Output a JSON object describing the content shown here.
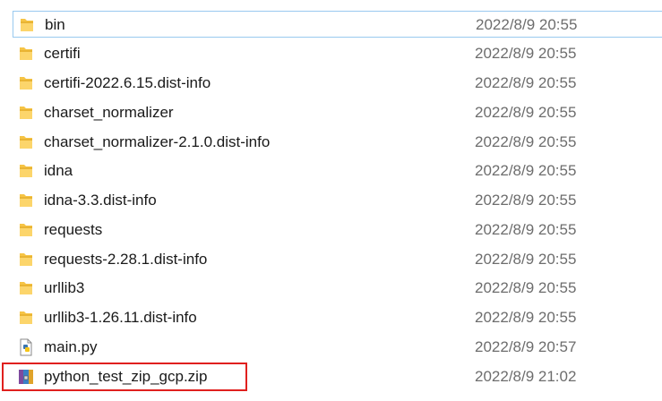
{
  "files": [
    {
      "name": "bin",
      "date": "2022/8/9 20:55",
      "icon": "folder-icon"
    },
    {
      "name": "certifi",
      "date": "2022/8/9 20:55",
      "icon": "folder-icon"
    },
    {
      "name": "certifi-2022.6.15.dist-info",
      "date": "2022/8/9 20:55",
      "icon": "folder-icon"
    },
    {
      "name": "charset_normalizer",
      "date": "2022/8/9 20:55",
      "icon": "folder-icon"
    },
    {
      "name": "charset_normalizer-2.1.0.dist-info",
      "date": "2022/8/9 20:55",
      "icon": "folder-icon"
    },
    {
      "name": "idna",
      "date": "2022/8/9 20:55",
      "icon": "folder-icon"
    },
    {
      "name": "idna-3.3.dist-info",
      "date": "2022/8/9 20:55",
      "icon": "folder-icon"
    },
    {
      "name": "requests",
      "date": "2022/8/9 20:55",
      "icon": "folder-icon"
    },
    {
      "name": "requests-2.28.1.dist-info",
      "date": "2022/8/9 20:55",
      "icon": "folder-icon"
    },
    {
      "name": "urllib3",
      "date": "2022/8/9 20:55",
      "icon": "folder-icon"
    },
    {
      "name": "urllib3-1.26.11.dist-info",
      "date": "2022/8/9 20:55",
      "icon": "folder-icon"
    },
    {
      "name": "main.py",
      "date": "2022/8/9 20:57",
      "icon": "python-file-icon"
    },
    {
      "name": "python_test_zip_gcp.zip",
      "date": "2022/8/9 21:02",
      "icon": "zip-archive-icon"
    }
  ],
  "colors": {
    "focus_border": "#99c9ef",
    "highlight_border": "#e0201e",
    "folder": "#f6c445",
    "date_text": "#6d6d6d"
  }
}
